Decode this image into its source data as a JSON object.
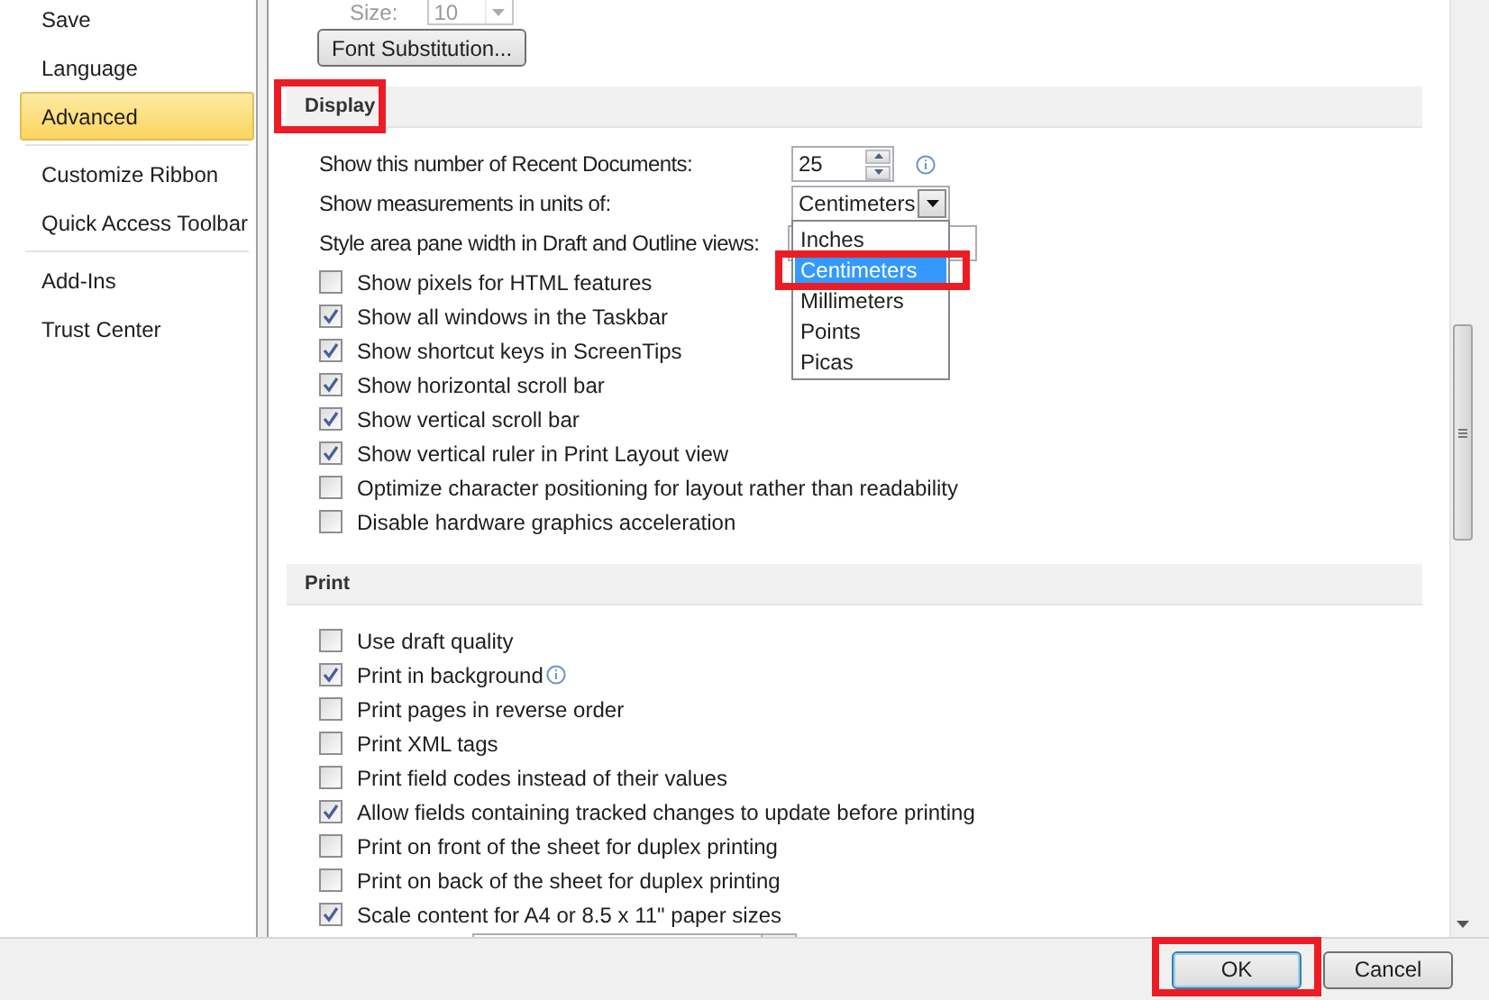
{
  "sidebar": {
    "items": [
      {
        "label": "Save",
        "selected": false
      },
      {
        "label": "Language",
        "selected": false
      },
      {
        "label": "Advanced",
        "selected": true
      },
      {
        "label": "Customize Ribbon",
        "selected": false
      },
      {
        "label": "Quick Access Toolbar",
        "selected": false
      },
      {
        "label": "Add-Ins",
        "selected": false
      },
      {
        "label": "Trust Center",
        "selected": false
      }
    ]
  },
  "font_section": {
    "size_label": "Size:",
    "size_value": "10",
    "disabled": true,
    "font_substitution_button": "Font Substitution..."
  },
  "display": {
    "title": "Display",
    "highlighted": true,
    "recent_documents": {
      "label": "Show this number of Recent Documents:",
      "value": "25"
    },
    "measurement_units": {
      "label": "Show measurements in units of:",
      "value": "Centimeters",
      "expanded": true,
      "options": [
        {
          "label": "Inches",
          "selected": false,
          "highlighted": false
        },
        {
          "label": "Centimeters",
          "selected": true,
          "highlighted": true
        },
        {
          "label": "Millimeters",
          "selected": false,
          "highlighted": false
        },
        {
          "label": "Points",
          "selected": false,
          "highlighted": false
        },
        {
          "label": "Picas",
          "selected": false,
          "highlighted": false
        }
      ]
    },
    "style_area": {
      "label": "Style area pane width in Draft and Outline views:"
    },
    "options": [
      {
        "label": "Show pixels for HTML features",
        "checked": false
      },
      {
        "label": "Show all windows in the Taskbar",
        "checked": true
      },
      {
        "label": "Show shortcut keys in ScreenTips",
        "checked": true
      },
      {
        "label": "Show horizontal scroll bar",
        "checked": true
      },
      {
        "label": "Show vertical scroll bar",
        "checked": true
      },
      {
        "label": "Show vertical ruler in Print Layout view",
        "checked": true
      },
      {
        "label": "Optimize character positioning for layout rather than readability",
        "checked": false
      },
      {
        "label": "Disable hardware graphics acceleration",
        "checked": false
      }
    ]
  },
  "print": {
    "title": "Print",
    "highlighted": false,
    "options": [
      {
        "label": "Use draft quality",
        "checked": false
      },
      {
        "label": "Print in background",
        "checked": true,
        "info_icon": true
      },
      {
        "label": "Print pages in reverse order",
        "checked": false
      },
      {
        "label": "Print XML tags",
        "checked": false
      },
      {
        "label": "Print field codes instead of their values",
        "checked": false
      },
      {
        "label": "Allow fields containing tracked changes to update before printing",
        "checked": true
      },
      {
        "label": "Print on front of the sheet for duplex printing",
        "checked": false
      },
      {
        "label": "Print on back of the sheet for duplex printing",
        "checked": false
      },
      {
        "label": "Scale content for A4 or 8.5 x 11\" paper sizes",
        "checked": true
      }
    ]
  },
  "buttons": [
    {
      "label": "OK",
      "default": true,
      "highlighted": true
    },
    {
      "label": "Cancel",
      "default": false,
      "highlighted": false
    }
  ]
}
